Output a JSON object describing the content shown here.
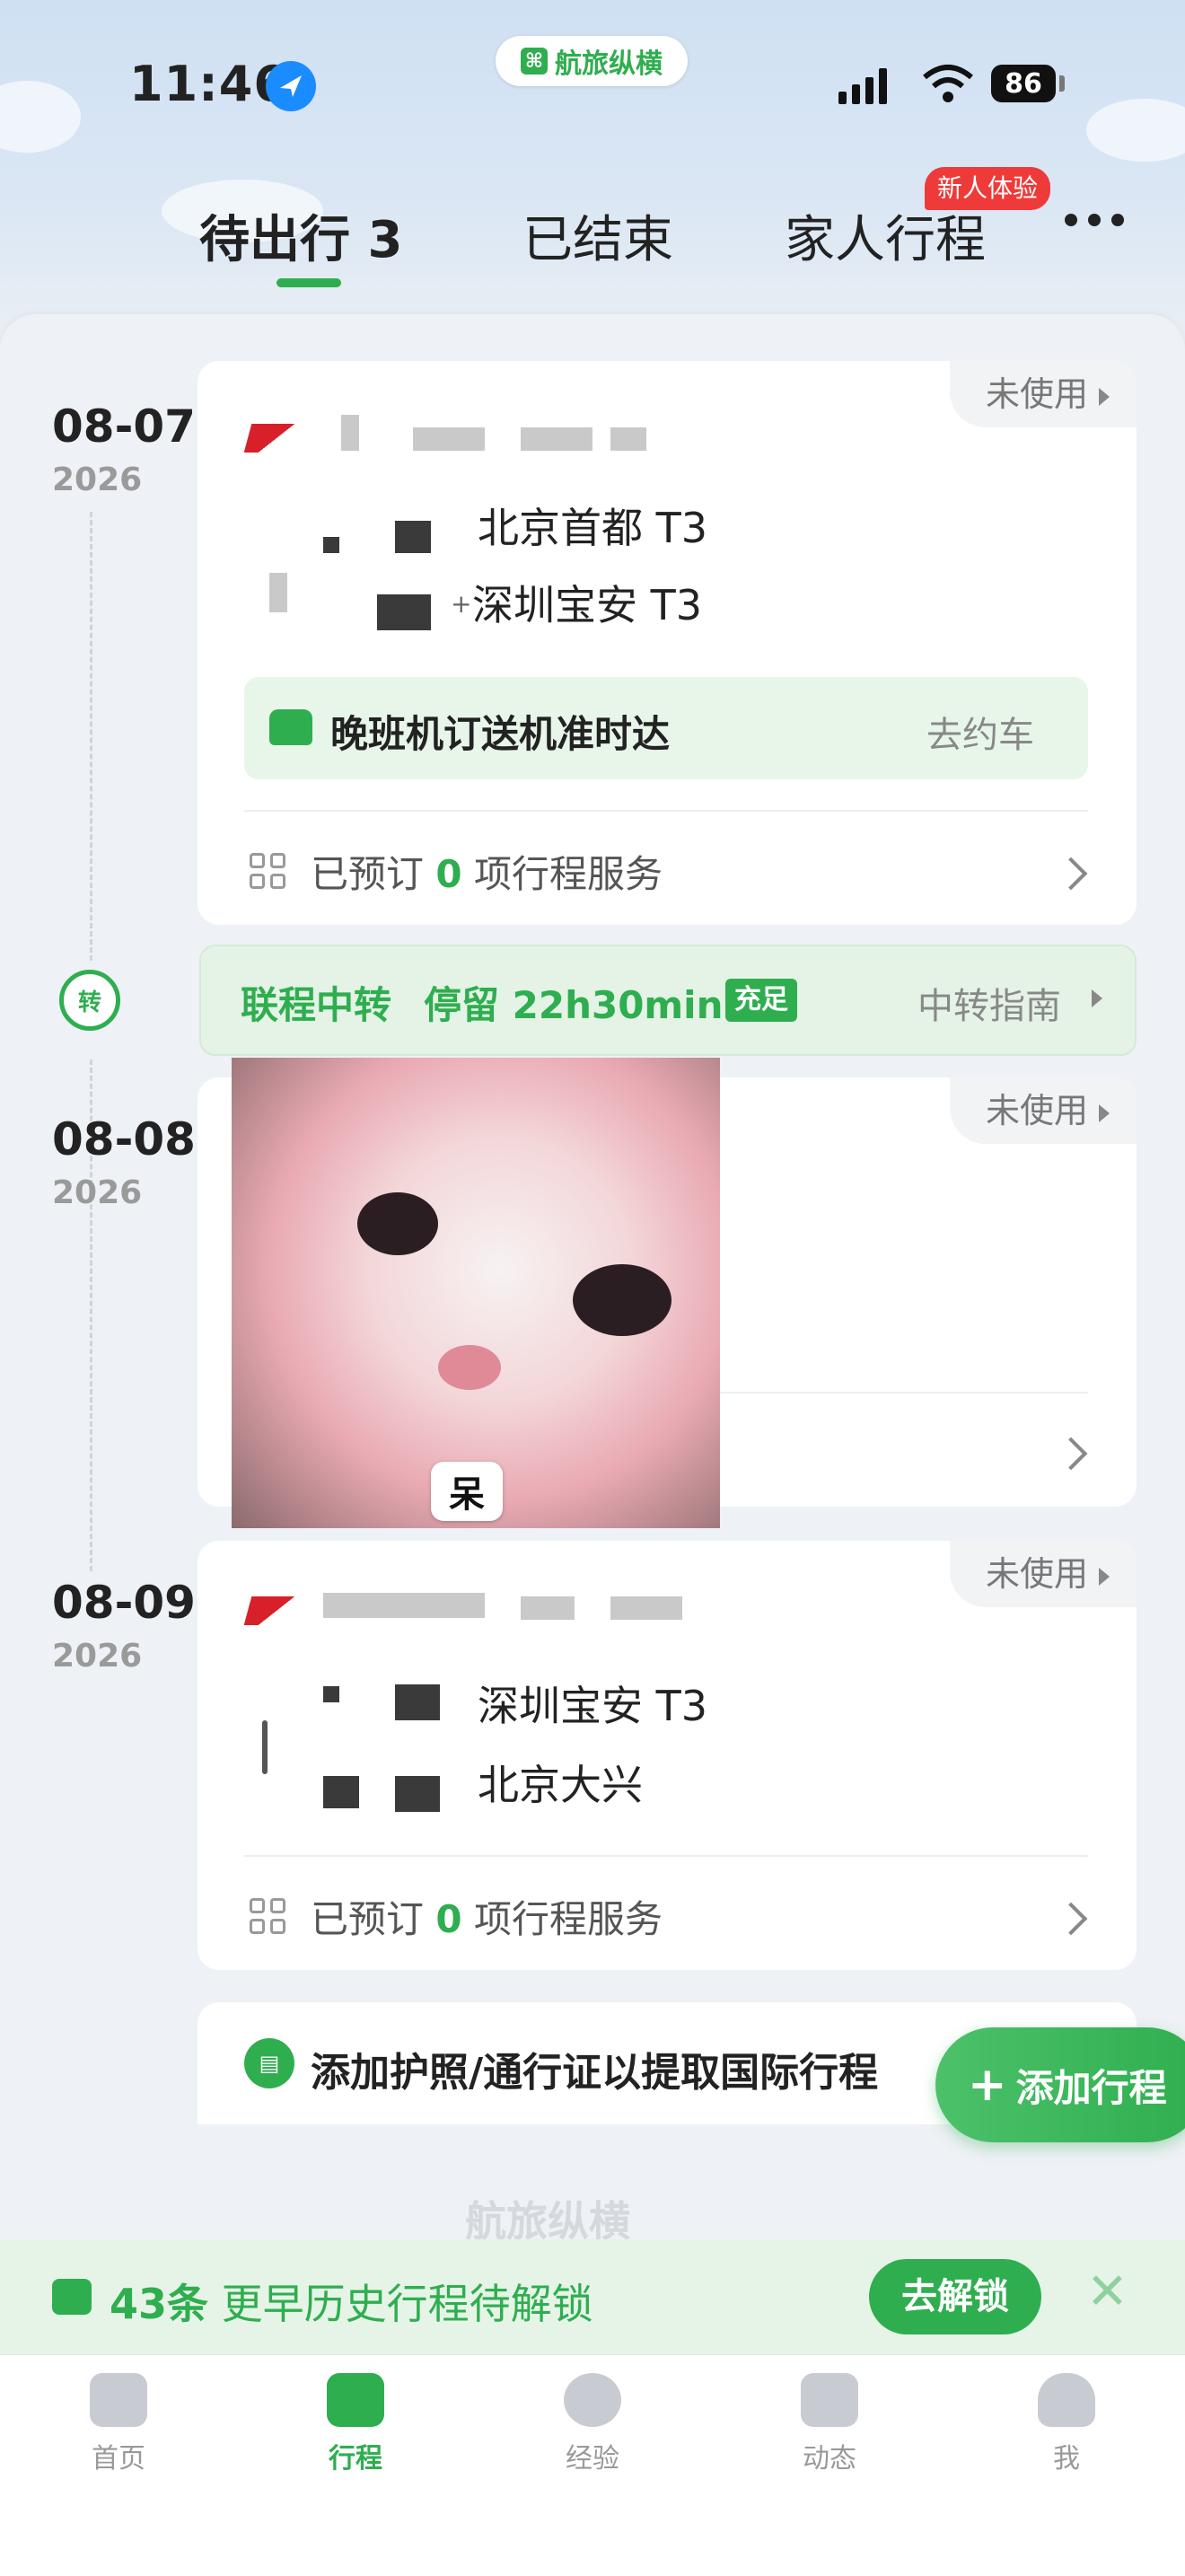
{
  "status_bar": {
    "time": "11:46",
    "battery": "86"
  },
  "brand": {
    "name": "航旅纵横"
  },
  "tabs": [
    {
      "label": "待出行 3",
      "active": true
    },
    {
      "label": "已结束"
    },
    {
      "label": "家人行程",
      "badge": "新人体验"
    }
  ],
  "trips": [
    {
      "date": "08-07",
      "year": "2026",
      "status": "未使用",
      "from": "北京首都 T3",
      "to": "深圳宝安 T3",
      "to_prefix": "+",
      "promo": {
        "text": "晚班机订送机准时达",
        "action": "去约车"
      },
      "services": {
        "prefix": "已预订",
        "count": "0",
        "suffix": "项行程服务"
      }
    },
    {
      "date": "08-08",
      "year": "2026",
      "status": "未使用",
      "overlay_label": "呆"
    },
    {
      "date": "08-09",
      "year": "2026",
      "status": "未使用",
      "from": "深圳宝安 T3",
      "to": "北京大兴",
      "services": {
        "prefix": "已预订",
        "count": "0",
        "suffix": "项行程服务"
      }
    }
  ],
  "transfer": {
    "icon_text": "转",
    "title": "联程中转",
    "stay": "停留 22h30min",
    "badge": "充足",
    "guide": "中转指南"
  },
  "passport": {
    "icon": "id-card-icon",
    "text": "添加护照/通行证以提取国际行程"
  },
  "fab": {
    "label": "添加行程"
  },
  "unlock": {
    "count": "43条",
    "text": "更早历史行程待解锁",
    "button": "去解锁"
  },
  "bottom_nav": [
    {
      "label": "首页",
      "icon": "home-icon"
    },
    {
      "label": "行程",
      "icon": "luggage-icon",
      "active": true
    },
    {
      "label": "经验",
      "icon": "planet-icon"
    },
    {
      "label": "动态",
      "icon": "flight-status-icon"
    },
    {
      "label": "我",
      "icon": "profile-icon"
    }
  ],
  "colors": {
    "accent": "#2fae4f",
    "badge_red": "#ef3a3a"
  }
}
